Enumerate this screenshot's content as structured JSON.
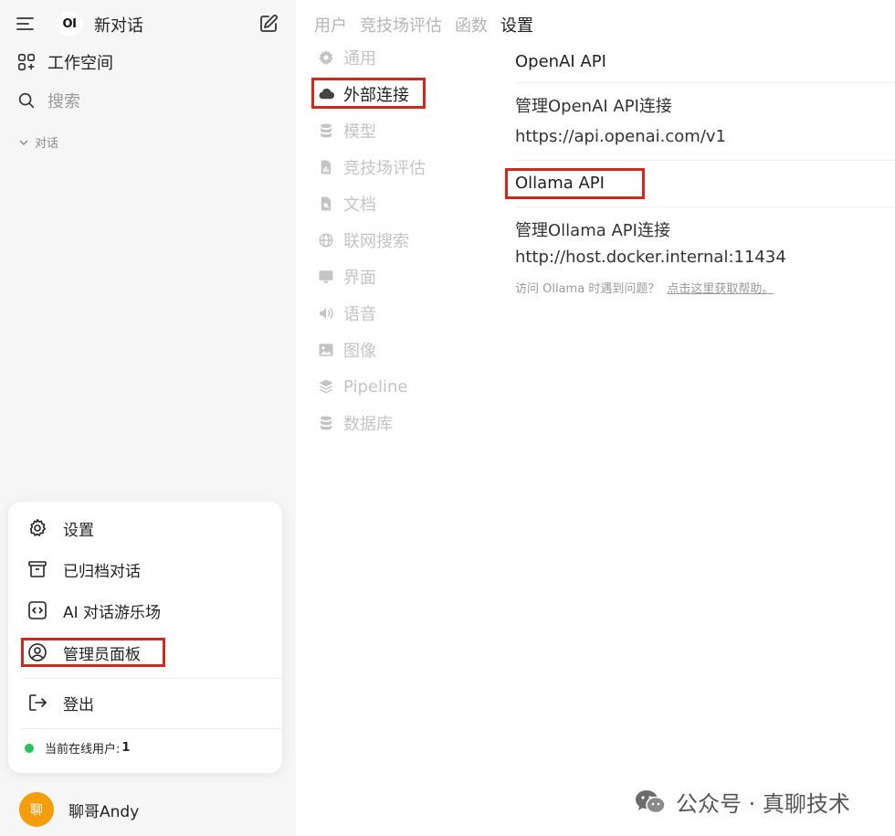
{
  "sidebar": {
    "logo_text": "OI",
    "new_chat": "新对话",
    "workspace": "工作空间",
    "search": "搜索",
    "chats_section": "对话",
    "user": {
      "avatar_char": "聊",
      "name": "聊哥Andy"
    }
  },
  "user_menu": {
    "settings": "设置",
    "archived": "已归档对话",
    "playground": "AI 对话游乐场",
    "admin_panel": "管理员面板",
    "logout": "登出",
    "online_label": "当前在线用户:",
    "online_count": "1"
  },
  "admin_tabs": [
    "用户",
    "竞技场评估",
    "函数",
    "设置"
  ],
  "settings_nav": [
    {
      "label": "通用",
      "icon": "gear-icon"
    },
    {
      "label": "外部连接",
      "icon": "cloud-icon"
    },
    {
      "label": "模型",
      "icon": "database-icon"
    },
    {
      "label": "竞技场评估",
      "icon": "chart-doc-icon"
    },
    {
      "label": "文档",
      "icon": "document-search-icon"
    },
    {
      "label": "联网搜索",
      "icon": "globe-icon"
    },
    {
      "label": "界面",
      "icon": "monitor-icon"
    },
    {
      "label": "语音",
      "icon": "speaker-icon"
    },
    {
      "label": "图像",
      "icon": "image-icon"
    },
    {
      "label": "Pipeline",
      "icon": "layers-icon"
    },
    {
      "label": "数据库",
      "icon": "database-icon"
    }
  ],
  "connections": {
    "openai_title": "OpenAI API",
    "openai_manage": "管理OpenAI API连接",
    "openai_url": "https://api.openai.com/v1",
    "ollama_title": "Ollama API",
    "ollama_manage": "管理Ollama API连接",
    "ollama_url": "http://host.docker.internal:11434",
    "help_text": "访问 Ollama 时遇到问题？",
    "help_link": "点击这里获取帮助。"
  },
  "watermark": "公众号 · 真聊技术",
  "colors": {
    "highlight": "#d7261b",
    "online": "#22c55e",
    "avatar": "#f59e0b"
  }
}
